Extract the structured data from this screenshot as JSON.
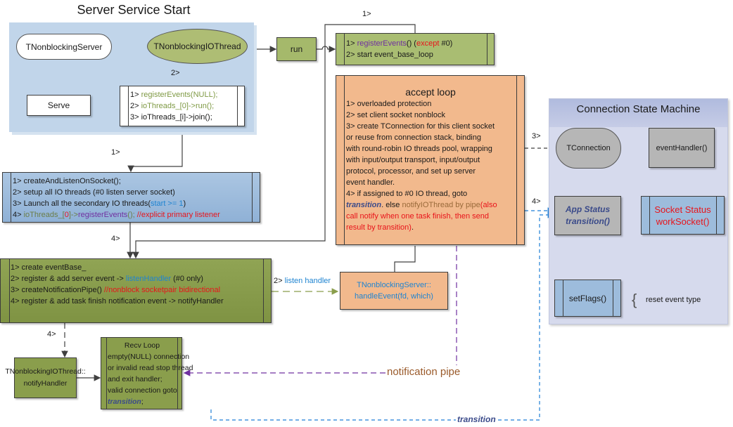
{
  "title": "Server Service Start",
  "server_group": {
    "server_node": "TNonblockingServer",
    "io_thread_node": "TNonblockingIOThread",
    "serve_node": "Serve",
    "edge_label_2": "2>",
    "steps": [
      [
        {
          "t": "1>  ",
          "c": ""
        },
        {
          "t": "registerEvents(NULL);",
          "c": "c-green"
        }
      ],
      [
        {
          "t": "2>  ",
          "c": ""
        },
        {
          "t": "ioThreads_[0]->run();",
          "c": "c-green"
        }
      ],
      [
        {
          "t": "3>  ioThreads_[i]->join();",
          "c": ""
        }
      ]
    ]
  },
  "run_node": "run",
  "run_steps": {
    "edge_label": "1>",
    "lines": [
      [
        {
          "t": "1>  ",
          "c": ""
        },
        {
          "t": "registerEvents",
          "c": "c-purple"
        },
        {
          "t": "() (",
          "c": ""
        },
        {
          "t": "except",
          "c": "c-red"
        },
        {
          "t": " #0)",
          "c": ""
        }
      ],
      [
        {
          "t": "2>  start event_base_loop",
          "c": ""
        }
      ]
    ]
  },
  "listen_setup": {
    "edge_label": "1>",
    "lines": [
      [
        {
          "t": "1>  createAndListenOnSocket();",
          "c": ""
        }
      ],
      [
        {
          "t": "2>  setup all IO threads (#0 listen server socket)",
          "c": ""
        }
      ],
      [
        {
          "t": "3>  Launch all the secondary IO threads(",
          "c": ""
        },
        {
          "t": "start >= 1",
          "c": "c-blue"
        },
        {
          "t": ")",
          "c": ""
        }
      ],
      [
        {
          "t": "4>  ",
          "c": ""
        },
        {
          "t": "ioThreads_[",
          "c": "c-olive"
        },
        {
          "t": "0",
          "c": "c-red"
        },
        {
          "t": "]->",
          "c": "c-olive"
        },
        {
          "t": "registerEvents",
          "c": "c-purple"
        },
        {
          "t": "(); ",
          "c": "c-olive"
        },
        {
          "t": "//explicit primary listener",
          "c": "c-red"
        }
      ]
    ]
  },
  "event_base": {
    "edge_label": "4>",
    "lines": [
      [
        {
          "t": "1>  create eventBase_",
          "c": ""
        }
      ],
      [
        {
          "t": "2>  register & add server event -> ",
          "c": ""
        },
        {
          "t": "listenHandler",
          "c": "c-blue"
        },
        {
          "t": "  (#0 only)",
          "c": ""
        }
      ],
      [
        {
          "t": "3>  createNotificationPipe() ",
          "c": ""
        },
        {
          "t": "//nonblock socketpair bidirectional",
          "c": "c-red"
        }
      ],
      [
        {
          "t": "4>  register & add task finish notification event -> notifyHandler",
          "c": ""
        }
      ]
    ]
  },
  "listen_handler_edge": {
    "num": "2> ",
    "text": "listen handler"
  },
  "handle_event": {
    "line1": "TNonblockingServer::",
    "line2": "handleEvent(fd, which)"
  },
  "accept_loop": {
    "title": "accept loop",
    "lines": [
      [
        {
          "t": "1>  overloaded protection",
          "c": ""
        }
      ],
      [
        {
          "t": "2>  set client socket nonblock",
          "c": ""
        }
      ],
      [
        {
          "t": "3>  create TConnection for this client socket",
          "c": ""
        }
      ],
      [
        {
          "t": " or reuse from connection stack, binding",
          "c": ""
        }
      ],
      [
        {
          "t": " with round-robin IO threads pool, wrapping",
          "c": ""
        }
      ],
      [
        {
          "t": " with input/output transport, input/output",
          "c": ""
        }
      ],
      [
        {
          "t": " protocol, processor, and set up server",
          "c": ""
        }
      ],
      [
        {
          "t": " event handler.",
          "c": ""
        }
      ],
      [
        {
          "t": "4>  if assigned to #0 IO thread, goto",
          "c": ""
        }
      ],
      [
        {
          "t": " transition",
          "c": "c-tr"
        },
        {
          "t": ". else ",
          "c": ""
        },
        {
          "t": "notifyIOThread by pipe",
          "c": "c-brown"
        },
        {
          "t": "(also",
          "c": "c-red"
        }
      ],
      [
        {
          "t": "call notify when one task finish, then send",
          "c": "c-red"
        }
      ],
      [
        {
          "t": "result by transition)",
          "c": "c-red"
        },
        {
          "t": ".",
          "c": ""
        }
      ]
    ]
  },
  "edge_3": "3>",
  "edge_4": "4>",
  "state_machine": {
    "title": "Connection State Machine",
    "tconnection": "TConnection",
    "event_handler": "eventHandler()",
    "app_status": {
      "line1": "App Status",
      "line2": "transition()"
    },
    "socket_status": {
      "line1": "Socket Status",
      "line2": "workSocket()"
    },
    "set_flags": "setFlags()",
    "reset_note": "reset event type"
  },
  "notify_handler": {
    "edge_label": "4>",
    "line1": "TNonblockingIOThread::",
    "line2": "notifyHandler"
  },
  "recv_loop": {
    "title": "Recv Loop",
    "lines": [
      [
        {
          "t": "empty(NULL) connection",
          "c": ""
        }
      ],
      [
        {
          "t": "or invalid read stop thread",
          "c": ""
        }
      ],
      [
        {
          "t": "and exit handler;",
          "c": ""
        }
      ],
      [
        {
          "t": "valid connection goto",
          "c": ""
        }
      ],
      [
        {
          "t": "transition",
          "c": "c-tr"
        },
        {
          "t": ";",
          "c": ""
        }
      ]
    ]
  },
  "notification_pipe_label": "notification pipe",
  "transition_label": "transition",
  "colors": {
    "group_blue": "#c3d6ea",
    "olive": "#8a9e4c",
    "light_olive": "#aebd74",
    "orange": "#f2b98d",
    "gray": "#b6b6b6",
    "blue_box": "#9dbcdc",
    "purple": "#7030a0",
    "dash_blue": "#1f7ed6",
    "yellow": "#ffc000"
  }
}
